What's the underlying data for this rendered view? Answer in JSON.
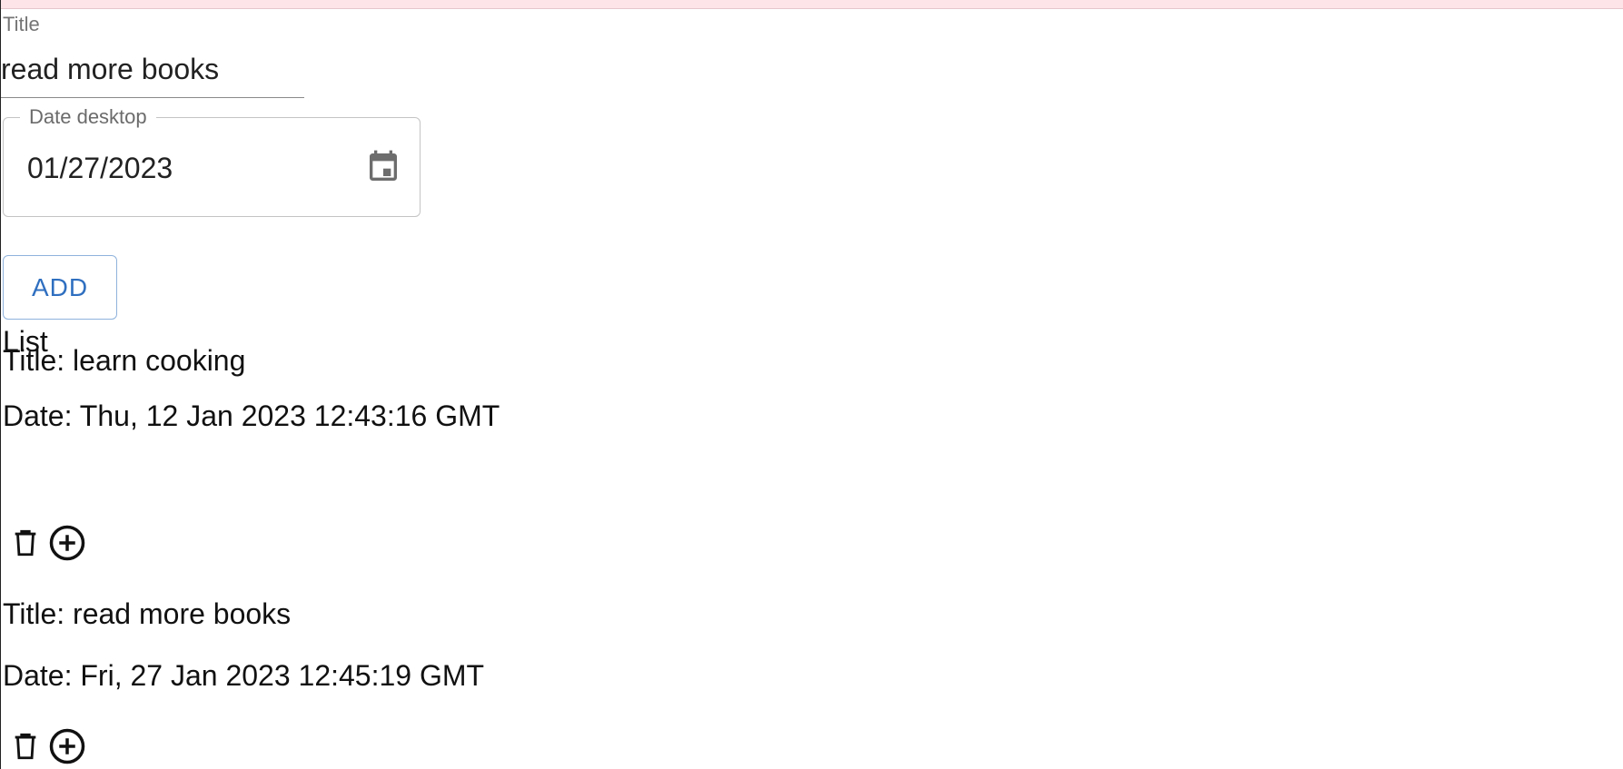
{
  "form": {
    "title_label": "Title",
    "title_value": "read more books",
    "date_label": "Date desktop",
    "date_value": "01/27/2023",
    "add_label": "ADD"
  },
  "list": {
    "heading": "List",
    "items": [
      {
        "title": "Title: learn cooking",
        "date": "Date: Thu, 12 Jan 2023 12:43:16 GMT"
      },
      {
        "title": "Title: read more books",
        "date": "Date: Fri, 27 Jan 2023 12:45:19 GMT"
      }
    ]
  },
  "icons": {
    "calendar": "calendar-icon",
    "delete": "trash-icon",
    "add": "add-circle-icon"
  },
  "colors": {
    "top_strip": "#fce4e8",
    "button_text": "#2f6fc0",
    "button_border": "#8fb2dc",
    "label": "#757575"
  }
}
